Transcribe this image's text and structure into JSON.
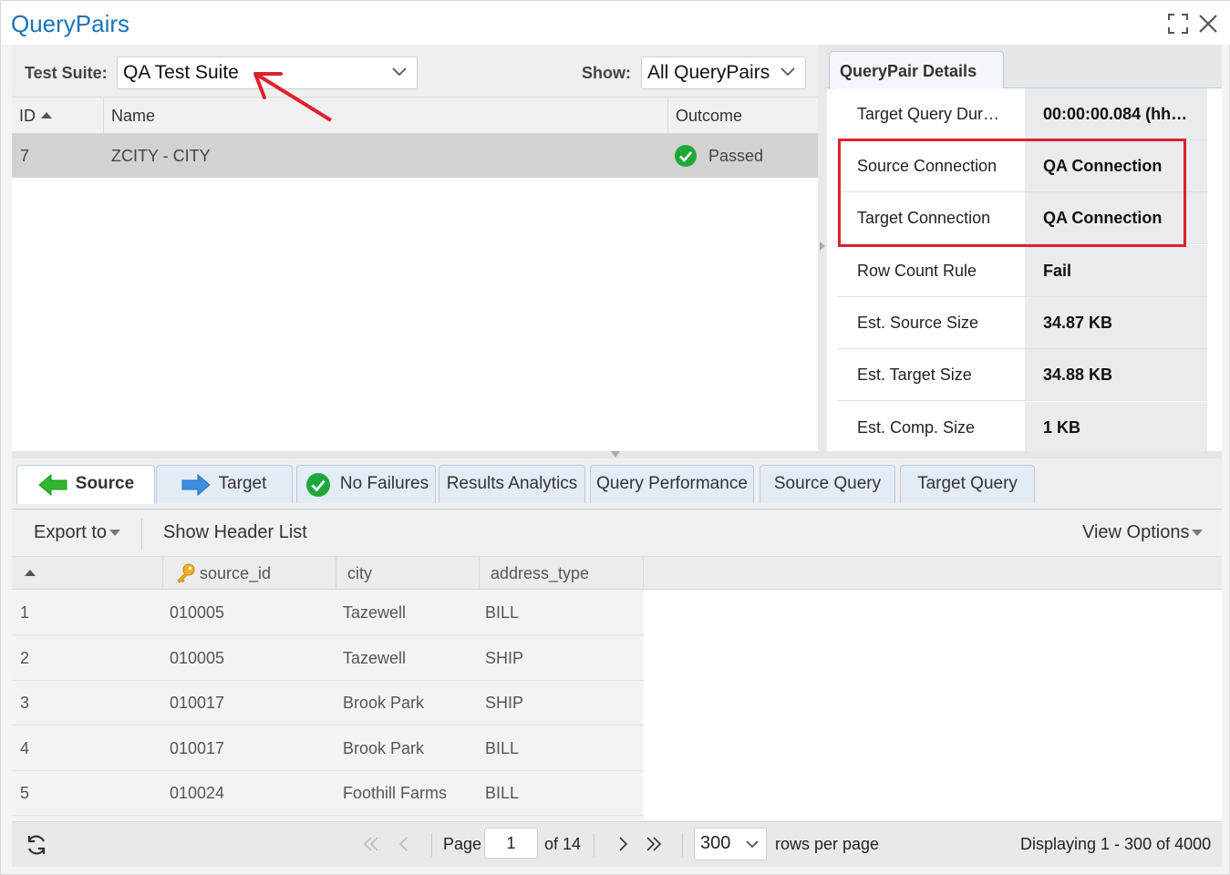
{
  "window": {
    "title": "QueryPairs",
    "icons": [
      "maximize-icon",
      "close-icon"
    ]
  },
  "top_panel": {
    "test_suite_label": "Test Suite:",
    "test_suite_value": "QA Test Suite",
    "show_label": "Show:",
    "show_value": "All QueryPairs",
    "columns": [
      "ID",
      "Name",
      "Outcome"
    ],
    "rows": [
      {
        "id": "7",
        "name": "ZCITY - CITY",
        "outcome": "Passed"
      }
    ]
  },
  "details": {
    "tab": "QueryPair Details",
    "props": [
      {
        "name": "Target Query Dur…",
        "value": "00:00:00.084 (hh…"
      },
      {
        "name": "Source Connection",
        "value": "QA Connection"
      },
      {
        "name": "Target Connection",
        "value": "QA Connection"
      },
      {
        "name": "Row Count Rule",
        "value": "Fail"
      },
      {
        "name": "Est. Source Size",
        "value": "34.87 KB"
      },
      {
        "name": "Est. Target Size",
        "value": "34.88 KB"
      },
      {
        "name": "Est. Comp. Size",
        "value": "1 KB"
      }
    ]
  },
  "tabs": [
    "Source",
    "Target",
    "No Failures",
    "Results Analytics",
    "Query Performance",
    "Source Query",
    "Target Query"
  ],
  "toolbar": {
    "export": "Export to",
    "header_list": "Show Header List",
    "view_options": "View Options"
  },
  "data_grid": {
    "columns": [
      "source_id",
      "city",
      "address_type"
    ],
    "rows": [
      {
        "n": "1",
        "source_id": "010005",
        "city": "Tazewell",
        "address_type": "BILL"
      },
      {
        "n": "2",
        "source_id": "010005",
        "city": "Tazewell",
        "address_type": "SHIP"
      },
      {
        "n": "3",
        "source_id": "010017",
        "city": "Brook Park",
        "address_type": "SHIP"
      },
      {
        "n": "4",
        "source_id": "010017",
        "city": "Brook Park",
        "address_type": "BILL"
      },
      {
        "n": "5",
        "source_id": "010024",
        "city": "Foothill Farms",
        "address_type": "BILL"
      }
    ]
  },
  "pager": {
    "page_label": "Page",
    "page": "1",
    "of": "of 14",
    "rows_per_page": "300",
    "rows_per_page_label": "rows per page",
    "displaying": "Displaying 1 - 300 of 4000"
  },
  "colors": {
    "accent": "#1a73b8",
    "success": "#1fa83a",
    "annotation": "#e0202e"
  }
}
